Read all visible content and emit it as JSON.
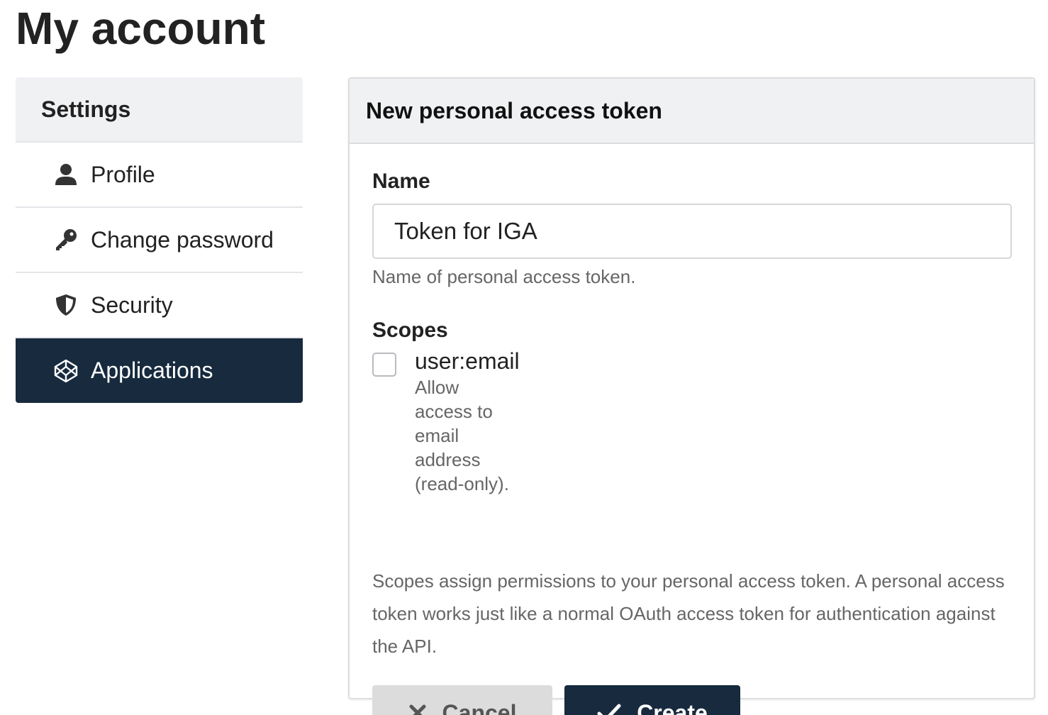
{
  "page": {
    "title": "My account"
  },
  "sidebar": {
    "header": "Settings",
    "items": [
      {
        "label": "Profile",
        "icon": "user-icon",
        "active": false
      },
      {
        "label": "Change password",
        "icon": "key-icon",
        "active": false
      },
      {
        "label": "Security",
        "icon": "shield-icon",
        "active": false
      },
      {
        "label": "Applications",
        "icon": "codepen-icon",
        "active": true
      }
    ],
    "active_color": "#172a3e"
  },
  "form": {
    "title": "New personal access token",
    "name_label": "Name",
    "name_value": "Token for IGA",
    "name_help": "Name of personal access token.",
    "scopes_label": "Scopes",
    "scopes": [
      {
        "name": "user:email",
        "description": "Allow access to email address (read-only).",
        "checked": false
      }
    ],
    "scopes_help": "Scopes assign permissions to your personal access token. A personal access token works just like a normal OAuth access token for authentication against the API.",
    "cancel_label": "Cancel",
    "create_label": "Create"
  }
}
